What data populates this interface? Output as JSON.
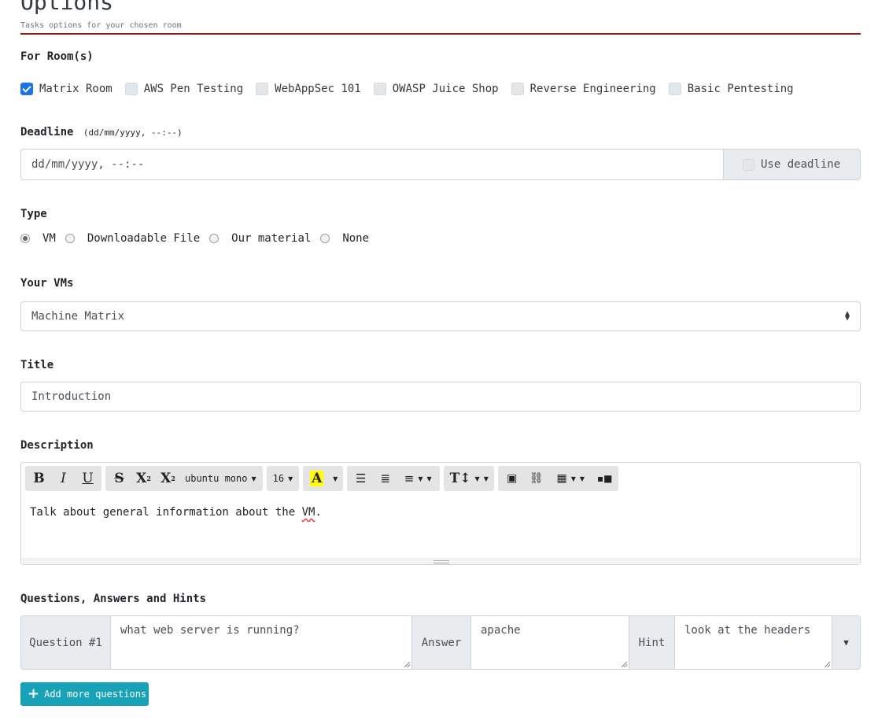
{
  "header": {
    "title": "Options",
    "subtitle": "Tasks options for your chosen room"
  },
  "rooms": {
    "label": "For Room(s)",
    "items": [
      {
        "label": "Matrix Room",
        "checked": true
      },
      {
        "label": "AWS Pen Testing",
        "checked": false
      },
      {
        "label": "WebAppSec 101",
        "checked": false
      },
      {
        "label": "OWASP Juice Shop",
        "checked": false
      },
      {
        "label": "Reverse Engineering",
        "checked": false
      },
      {
        "label": "Basic Pentesting",
        "checked": false
      }
    ]
  },
  "deadline": {
    "label": "Deadline",
    "format_hint": "(dd/mm/yyyy, --:--)",
    "placeholder": "dd/mm/yyyy, --:--",
    "use_deadline_label": "Use deadline"
  },
  "type": {
    "label": "Type",
    "options": [
      {
        "label": "VM",
        "checked": true
      },
      {
        "label": "Downloadable File",
        "checked": false
      },
      {
        "label": "Our material",
        "checked": false
      },
      {
        "label": "None",
        "checked": false
      }
    ]
  },
  "vms": {
    "label": "Your VMs",
    "selected": "Machine Matrix"
  },
  "title_field": {
    "label": "Title",
    "value": "Introduction"
  },
  "description": {
    "label": "Description",
    "font_name": "ubuntu mono",
    "font_size": "16",
    "content_before": "Talk about general information about the ",
    "content_misspelled": "VM",
    "content_after": "."
  },
  "questions": {
    "label": "Questions, Answers and Hints",
    "rows": [
      {
        "question_label": "Question #1",
        "question_value": "what web server is running?",
        "answer_label": "Answer",
        "answer_value": "apache",
        "hint_label": "Hint",
        "hint_value": "look at the headers"
      }
    ],
    "add_button_label": "Add more questions"
  },
  "colors": {
    "accent_line": "#8b1c1c",
    "checkbox_checked": "#1a73e8",
    "add_button": "#17a2b8"
  }
}
